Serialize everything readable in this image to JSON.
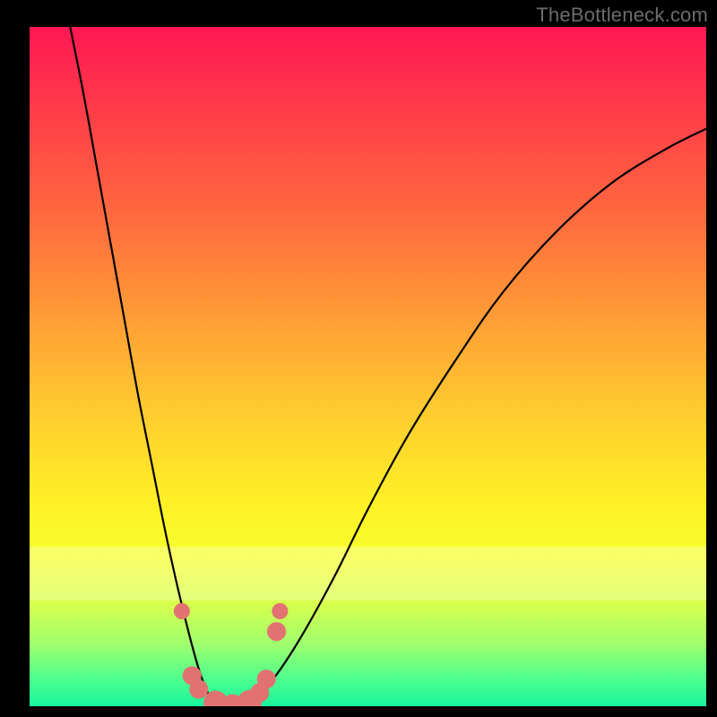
{
  "watermark": "TheBottleneck.com",
  "chart_data": {
    "type": "line",
    "title": "",
    "xlabel": "",
    "ylabel": "",
    "xlim": [
      0,
      100
    ],
    "ylim": [
      0,
      100
    ],
    "series": [
      {
        "name": "bottleneck-curve",
        "x": [
          6,
          8,
          10,
          12,
          14,
          16,
          18,
          20,
          22,
          24,
          25.5,
          27,
          29,
          31,
          33,
          36,
          40,
          45,
          50,
          56,
          63,
          70,
          78,
          86,
          94,
          100
        ],
        "values": [
          100,
          90,
          79,
          68,
          57,
          46,
          36,
          26,
          17,
          9,
          4,
          1,
          0,
          0,
          1,
          4,
          10,
          19,
          29,
          40,
          51,
          61,
          70,
          77,
          82,
          85
        ]
      }
    ],
    "markers": [
      {
        "x": 22.5,
        "y": 14,
        "r": 1.2
      },
      {
        "x": 24.0,
        "y": 4.5,
        "r": 1.4
      },
      {
        "x": 25.0,
        "y": 2.5,
        "r": 1.4
      },
      {
        "x": 27.5,
        "y": 0.5,
        "r": 1.8
      },
      {
        "x": 30.0,
        "y": 0.4,
        "r": 1.4
      },
      {
        "x": 32.5,
        "y": 0.6,
        "r": 1.8
      },
      {
        "x": 34.0,
        "y": 2.0,
        "r": 1.4
      },
      {
        "x": 35.0,
        "y": 4.0,
        "r": 1.4
      },
      {
        "x": 36.5,
        "y": 11.0,
        "r": 1.4
      },
      {
        "x": 37.0,
        "y": 14.0,
        "r": 1.2
      }
    ]
  }
}
